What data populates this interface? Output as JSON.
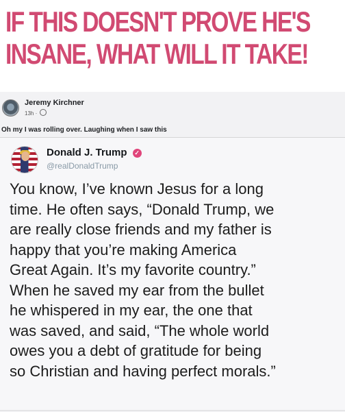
{
  "headline": {
    "line1": "IF THIS DOESN'T PROVE HE'S",
    "line2": "INSANE, WHAT WILL IT TAKE!"
  },
  "facebook_post": {
    "author": "Jeremy Kirchner",
    "time": "13h ·",
    "body": "Oh my I was rolling over. Laughing when I saw this",
    "privacy_icon": "globe-icon"
  },
  "tweet": {
    "name": "Donald J. Trump",
    "handle": "@realDonaldTrump",
    "verified_icon": "verified-badge-icon",
    "lines": [
      "You know, I’ve known Jesus for a long",
      "time. He often says, “Donald Trump, we",
      "are really close friends and my father is",
      "happy that you’re making America",
      "Great Again. It’s my favorite country.”",
      "When he saved my ear from the bullet",
      "he whispered in my ear, the one that",
      "was saved, and said, “The whole world",
      "owes you a debt of gratitude for being",
      "so Christian and having perfect morals.”"
    ]
  },
  "colors": {
    "headline": "#d14a72",
    "verified_badge": "#e0457b",
    "handle": "#8899a6"
  }
}
